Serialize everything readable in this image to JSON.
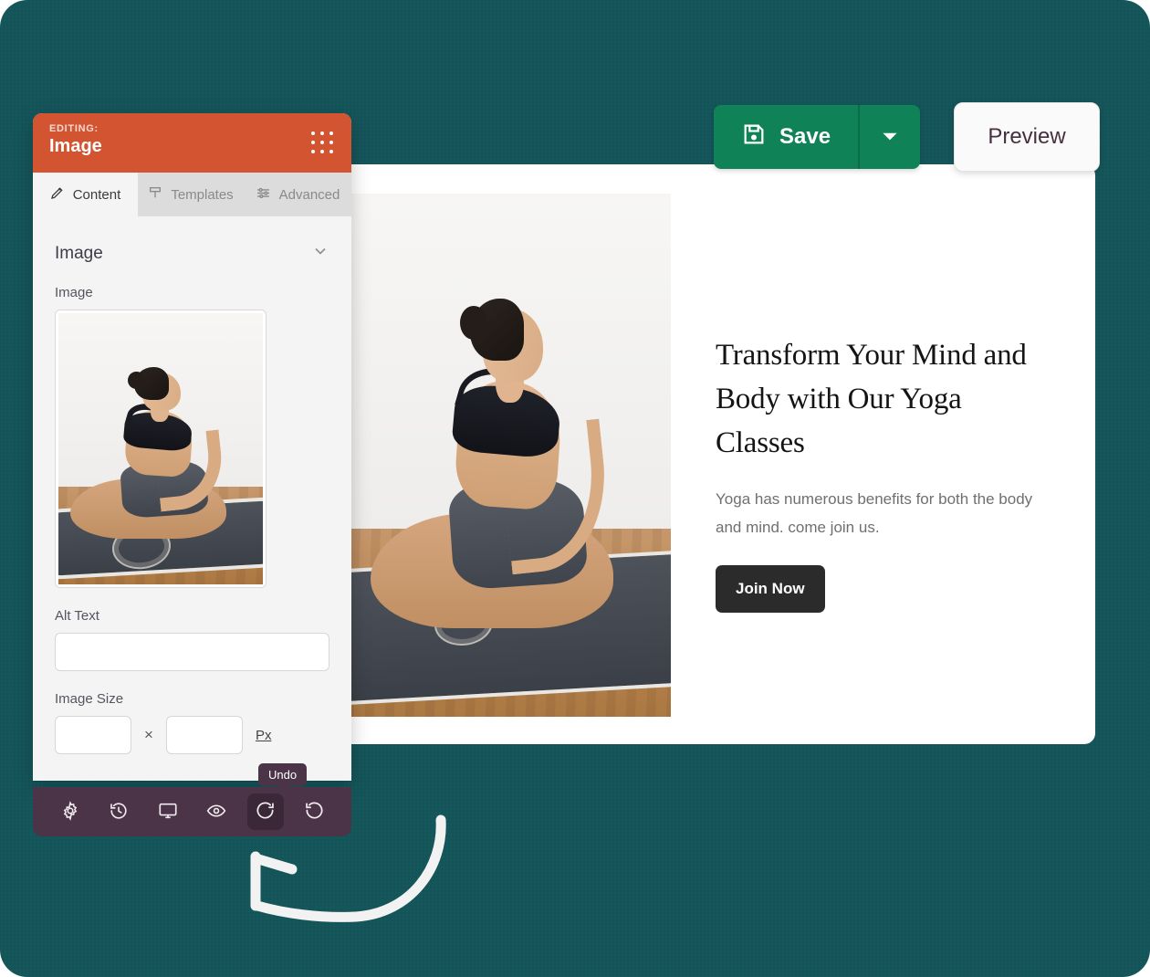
{
  "theme": {
    "background": "#14555a",
    "sidebar_header": "#d35430",
    "toolbar": "#4b3448",
    "save_green": "#0f8257",
    "cta_dark": "#2b2b2b"
  },
  "actions": {
    "save_label": "Save",
    "save_icon": "floppy-disk-icon",
    "save_caret_icon": "chevron-down-icon",
    "preview_label": "Preview"
  },
  "sidebar": {
    "editing_label": "EDITING:",
    "editing_target": "Image",
    "drag_handle_icon": "grid-dots-icon",
    "tabs": [
      {
        "label": "Content",
        "icon": "pencil-icon",
        "active": true
      },
      {
        "label": "Templates",
        "icon": "template-icon",
        "active": false
      },
      {
        "label": "Advanced",
        "icon": "sliders-icon",
        "active": false
      }
    ],
    "section": {
      "title": "Image",
      "collapse_icon": "chevron-down-icon"
    },
    "fields": {
      "image_label": "Image",
      "image_thumb_alt": "woman-sitting-lotus-pose-on-yoga-mat",
      "alt_text_label": "Alt Text",
      "alt_text_value": "",
      "alt_text_placeholder": "",
      "image_size_label": "Image Size",
      "width_value": "",
      "height_value": "",
      "size_separator": "×",
      "px_link": "Px"
    }
  },
  "toolbar": {
    "buttons": [
      {
        "name": "settings",
        "icon": "gear-icon",
        "active": false
      },
      {
        "name": "revisions",
        "icon": "history-clock-icon",
        "active": false
      },
      {
        "name": "responsive",
        "icon": "desktop-monitor-icon",
        "active": false
      },
      {
        "name": "preview",
        "icon": "eye-icon",
        "active": false
      },
      {
        "name": "undo",
        "icon": "undo-arrow-icon",
        "active": true
      },
      {
        "name": "redo",
        "icon": "redo-arrow-icon",
        "active": false
      }
    ],
    "tooltip": "Undo"
  },
  "canvas": {
    "hero": {
      "title": "Transform Your Mind and Body with Our Yoga Classes",
      "subtitle": "Yoga has numerous benefits for both the body and mind. come join us.",
      "cta_label": "Join Now",
      "image_alt": "woman-sitting-lotus-pose-on-yoga-mat"
    }
  },
  "annotation": {
    "arrow_icon": "curved-arrow-pointing-to-undo"
  }
}
